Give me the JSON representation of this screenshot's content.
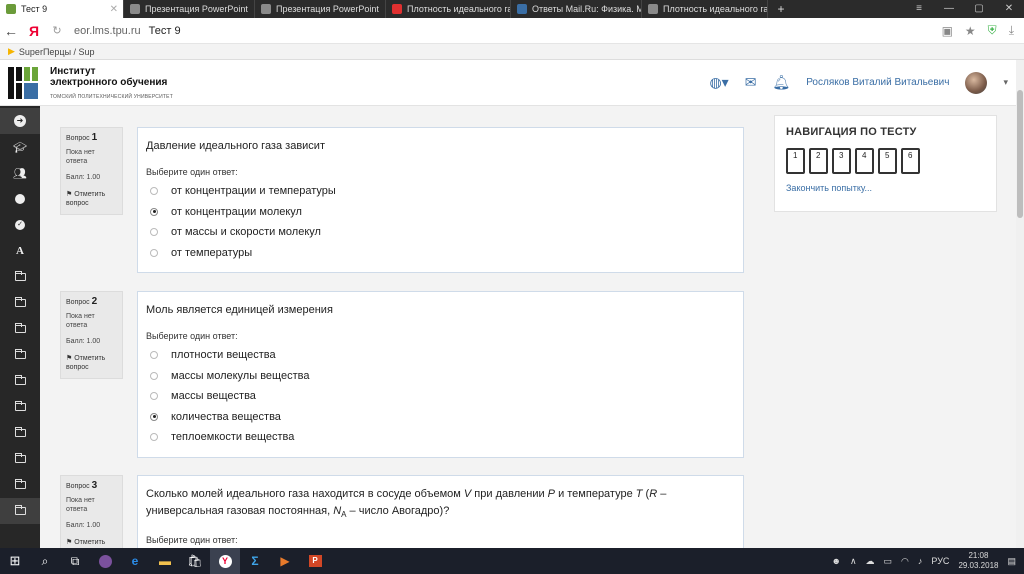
{
  "browser": {
    "tabs": [
      {
        "title": "Тест 9",
        "active": true,
        "color": "#6b9b3a"
      },
      {
        "title": "Презентация PowerPoint",
        "color": "#8a8a8a"
      },
      {
        "title": "Презентация PowerPoint",
        "color": "#8a8a8a"
      },
      {
        "title": "Плотность идеального газа",
        "color": "#e03030"
      },
      {
        "title": "Ответы Mail.Ru: Физика. М",
        "color": "#3a6ea5"
      },
      {
        "title": "Плотность идеального газ",
        "color": "#8a8a8a"
      }
    ],
    "new_tab": "+",
    "address_domain": "eor.lms.tpu.ru",
    "page_title": "Тест 9",
    "yandex_logo": "Я",
    "bookmark_label": "SuperПерцы / Sup"
  },
  "header": {
    "logo_line1": "Институт",
    "logo_line2": "электронного обучения",
    "logo_line3": "ТОМСКИЙ ПОЛИТЕХНИЧЕСКИЙ УНИВЕРСИТЕТ",
    "username": "Росляков Виталий Витальевич",
    "colors": {
      "logo_green": "#6ba539",
      "logo_blue": "#3a6ea5"
    }
  },
  "sidebar": {
    "items": [
      "arrow-circle-icon",
      "graduation-cap-icon",
      "users-icon",
      "circle-icon",
      "check-circle-icon",
      "font-a-icon",
      "folder-icon",
      "folder-icon",
      "folder-icon",
      "folder-icon",
      "folder-icon",
      "folder-icon",
      "folder-icon",
      "folder-icon",
      "folder-icon",
      "folder-icon"
    ],
    "letter_a": "A"
  },
  "questions": [
    {
      "label": "Вопрос",
      "number": "1",
      "status": "Пока нет ответа",
      "grade": "Балл: 1.00",
      "flag": "Отметить вопрос",
      "text": "Давление идеального газа зависит",
      "prompt": "Выберите один ответ:",
      "answers": [
        {
          "text": "от концентрации и температуры",
          "selected": false
        },
        {
          "text": "от концентрации молекул",
          "selected": true
        },
        {
          "text": "от массы и скорости молекул",
          "selected": false
        },
        {
          "text": "от температуры",
          "selected": false
        }
      ]
    },
    {
      "label": "Вопрос",
      "number": "2",
      "status": "Пока нет ответа",
      "grade": "Балл: 1.00",
      "flag": "Отметить вопрос",
      "text": "Моль является единицей измерения",
      "prompt": "Выберите один ответ:",
      "answers": [
        {
          "text": "плотности вещества",
          "selected": false
        },
        {
          "text": "массы молекулы вещества",
          "selected": false
        },
        {
          "text": "массы вещества",
          "selected": false
        },
        {
          "text": "количества вещества",
          "selected": true
        },
        {
          "text": "теплоемкости вещества",
          "selected": false
        }
      ]
    },
    {
      "label": "Вопрос",
      "number": "3",
      "status": "Пока нет ответа",
      "grade": "Балл: 1.00",
      "flag": "Отметить",
      "text_parts": {
        "a": "Сколько молей идеального газа находится в сосуде объемом ",
        "v": "V",
        "b": " при давлении ",
        "p": "P",
        "c": " и температуре ",
        "t": "T",
        "d": " (",
        "r": "R",
        "e": " – универсальная газовая постоянная, ",
        "n": "N",
        "nsub": "A",
        "f": " – число Авогадро)?"
      },
      "prompt": "Выберите один ответ:"
    }
  ],
  "quiz_nav": {
    "title": "НАВИГАЦИЯ ПО ТЕСТУ",
    "buttons": [
      "1",
      "2",
      "3",
      "4",
      "5",
      "6"
    ],
    "finish": "Закончить попытку..."
  },
  "taskbar": {
    "lang": "РУС",
    "time": "21:08",
    "date": "29.03.2018"
  }
}
